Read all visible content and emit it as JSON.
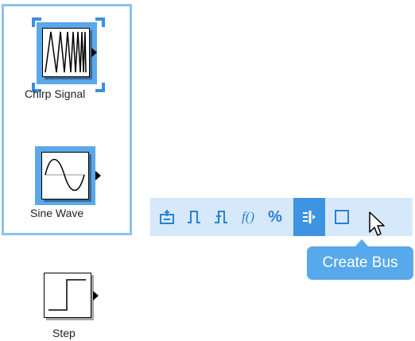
{
  "blocks": {
    "chirp": {
      "label": "Chirp Signal"
    },
    "sine": {
      "label": "Sine Wave"
    },
    "step": {
      "label": "Step"
    }
  },
  "toolbar": {
    "items": [
      {
        "name": "bus-element-icon",
        "glyph": "⏚"
      },
      {
        "name": "pulse-icon",
        "glyph": "⎍"
      },
      {
        "name": "step-pulse-icon",
        "glyph": "⎍"
      },
      {
        "name": "function-icon",
        "glyph": "f()"
      },
      {
        "name": "percent-icon",
        "glyph": "%"
      },
      {
        "name": "create-bus-icon",
        "glyph": "⫶"
      },
      {
        "name": "subsystem-icon",
        "glyph": "☐"
      }
    ],
    "active_index": 5
  },
  "tooltip": {
    "text": "Create Bus"
  },
  "colors": {
    "selection": "#8cc2ef",
    "highlight": "#5ba8ea",
    "toolbar_bg": "#d6e9fa",
    "toolbar_icon": "#2b7fd6",
    "active": "#3e93e3"
  }
}
